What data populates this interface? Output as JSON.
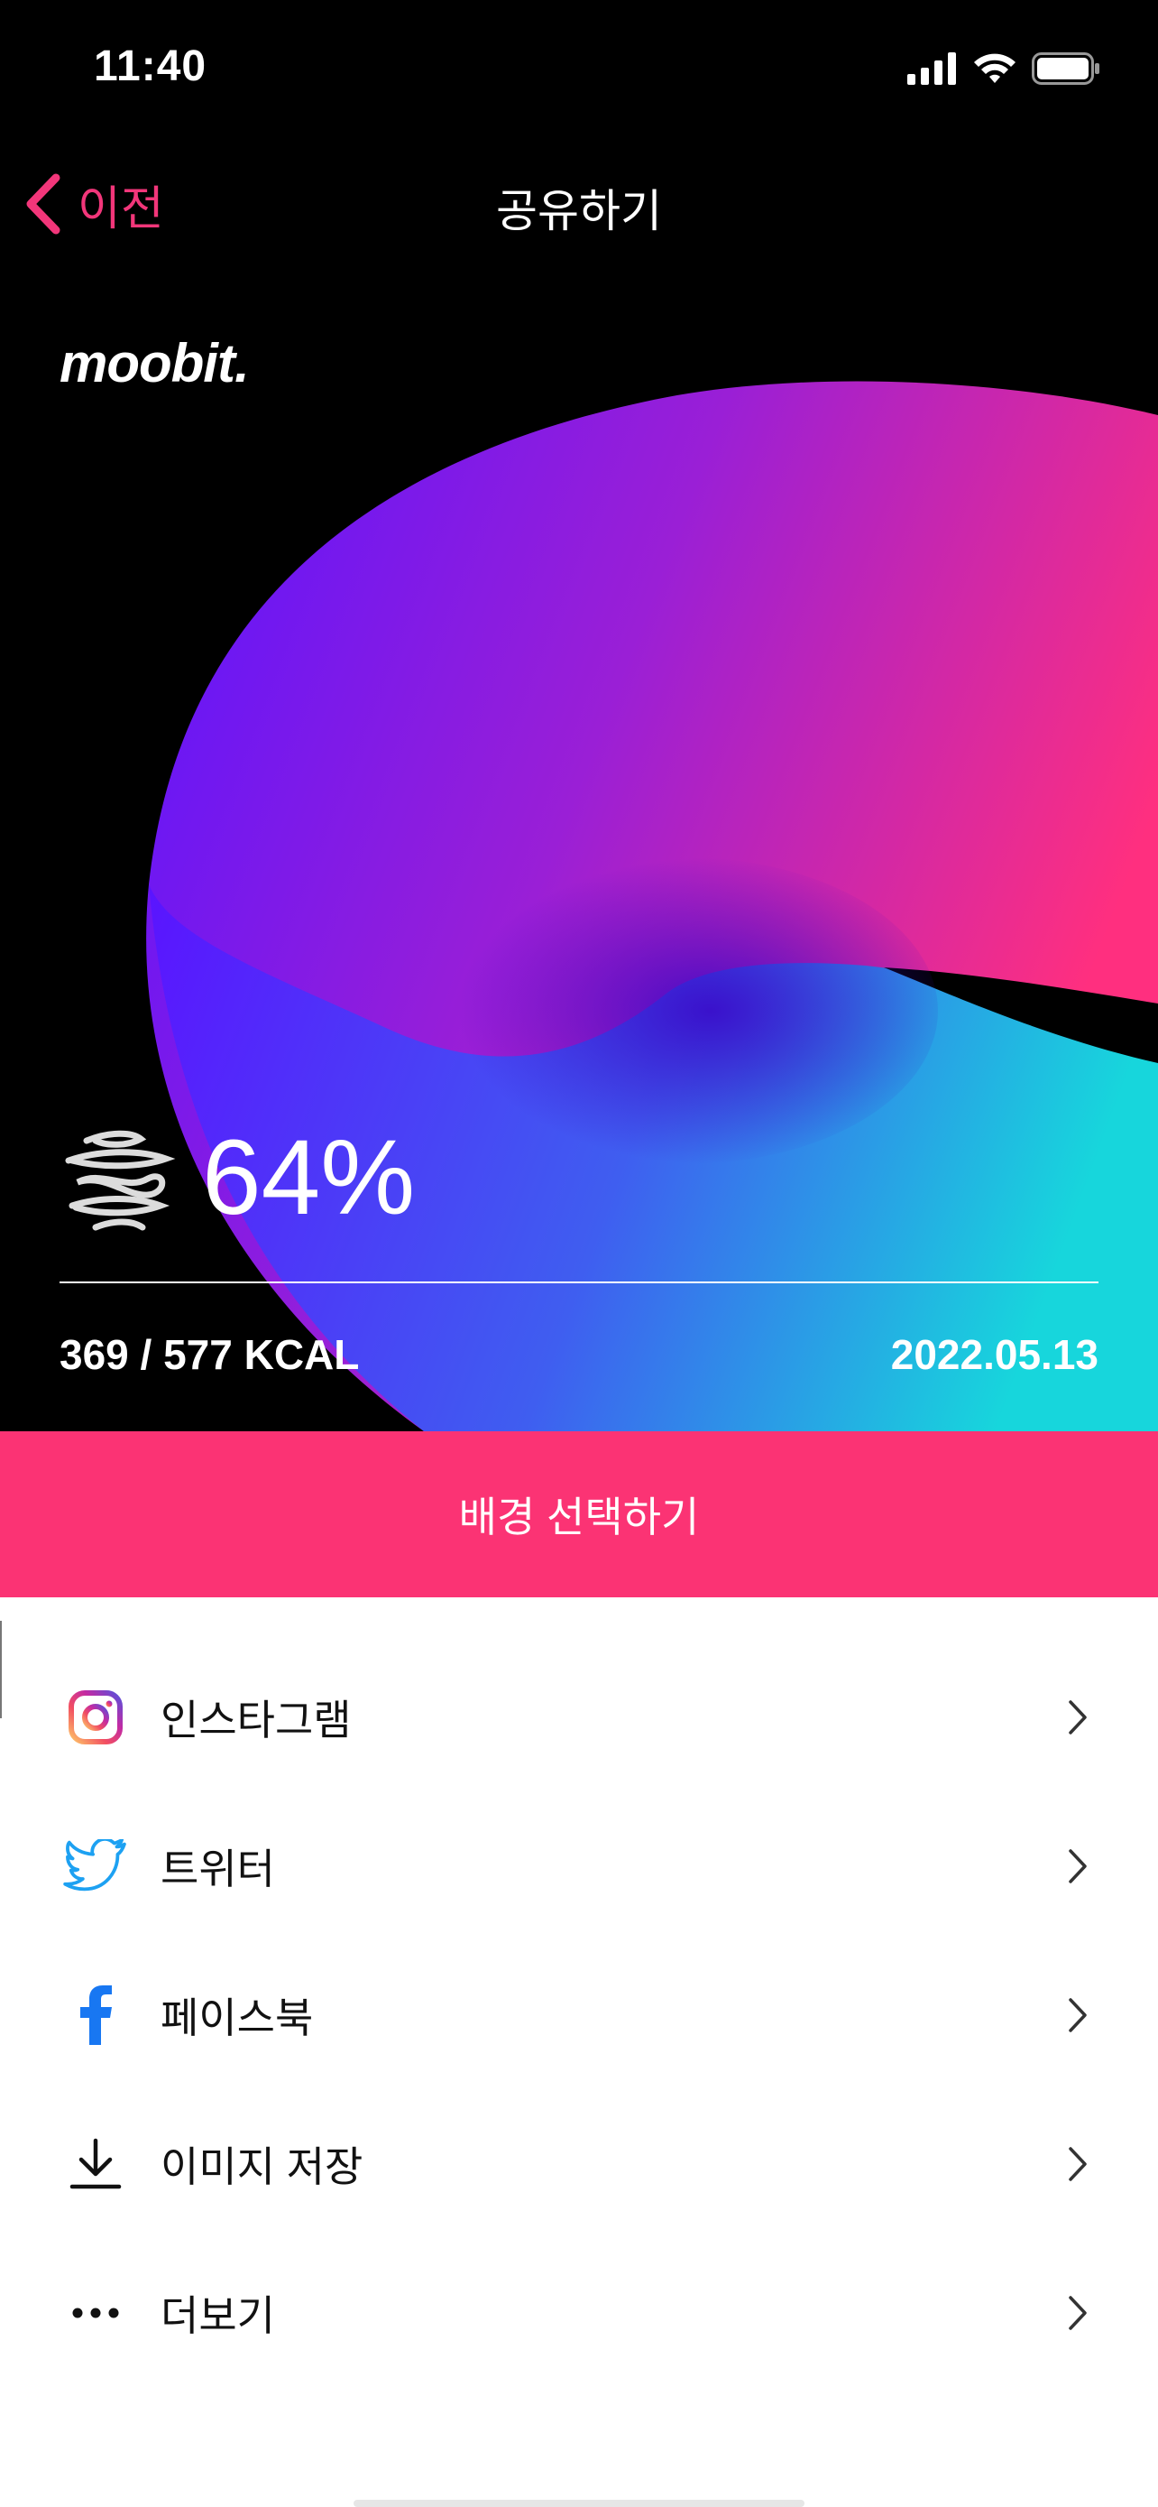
{
  "status_bar": {
    "time": "11:40"
  },
  "nav": {
    "back_label": "이전",
    "title": "공유하기"
  },
  "card": {
    "logo": "moobit.",
    "progress": "64%",
    "kcal": "369 / 577 KCAL",
    "date": "2022.05.13"
  },
  "background_button": {
    "label": "배경 선택하기"
  },
  "share_items": [
    {
      "label": "인스타그램",
      "icon": "instagram-icon"
    },
    {
      "label": "트위터",
      "icon": "twitter-icon"
    },
    {
      "label": "페이스북",
      "icon": "facebook-icon"
    },
    {
      "label": "이미지 저장",
      "icon": "download-icon"
    },
    {
      "label": "더보기",
      "icon": "more-icon"
    }
  ],
  "colors": {
    "accent": "#fb3374",
    "back": "#f2367a",
    "twitter": "#1da1f2",
    "facebook": "#1877f2"
  }
}
